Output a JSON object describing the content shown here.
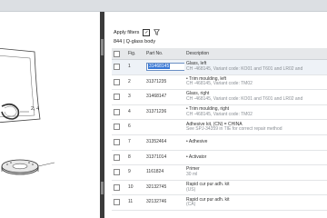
{
  "filters": {
    "label": "Apply filters",
    "checked_mark": "✓",
    "icon": "filter-icon"
  },
  "breadcrumb": "844 | Q-glass body",
  "diagram": {
    "callout": "2, 4"
  },
  "table": {
    "headers": {
      "checkbox": "",
      "fig": "Fig.",
      "part": "Part No.",
      "desc": "Description"
    },
    "rows": [
      {
        "fig": "1",
        "part": "31468145",
        "desc": "Glass, left",
        "sub": "CH -468145, Variant code: KO01 and T601 and LR02 and",
        "selected": true
      },
      {
        "fig": "2",
        "part": "31371235",
        "desc": "• Trim moulding, left",
        "sub": "CH -468145, Variant code: TM02"
      },
      {
        "fig": "3",
        "part": "31468147",
        "desc": "Glass, right",
        "sub": "CH -468145, Variant code: KO01 and T601 and LR02 and"
      },
      {
        "fig": "4",
        "part": "31371236",
        "desc": "• Trim moulding, right",
        "sub": "CH -468145, Variant code: TM02"
      },
      {
        "fig": "6",
        "part": "",
        "desc": "Adhesive kit, (CN) = CHINA",
        "sub": "See SPJ-34359 in TIE for correct repair method"
      },
      {
        "fig": "7",
        "part": "31352464",
        "desc": "• Adhesive",
        "sub": ""
      },
      {
        "fig": "8",
        "part": "31371014",
        "desc": "• Activator",
        "sub": ""
      },
      {
        "fig": "9",
        "part": "1161824",
        "desc": "Primer",
        "sub": "30 ml"
      },
      {
        "fig": "10",
        "part": "32132745",
        "desc": "Rapid cur pur adh. kit",
        "sub": "(US)"
      },
      {
        "fig": "11",
        "part": "32132746",
        "desc": "Rapid cur pur adh. kit",
        "sub": "(CA)"
      }
    ]
  }
}
